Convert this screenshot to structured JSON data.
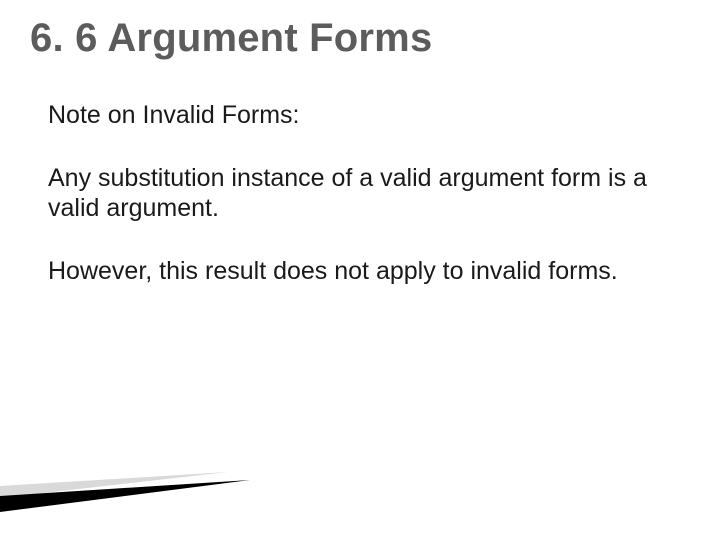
{
  "slide": {
    "title": "6. 6 Argument Forms",
    "paragraphs": {
      "p1": "Note on Invalid Forms:",
      "p2": "Any substitution instance of a valid argument form is a valid argument.",
      "p3": "However, this result does not apply to invalid forms."
    }
  }
}
